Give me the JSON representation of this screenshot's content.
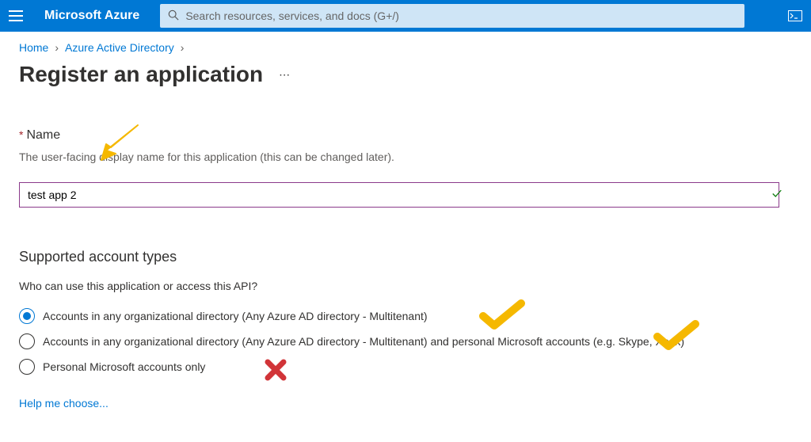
{
  "topbar": {
    "logo": "Microsoft Azure",
    "search_placeholder": "Search resources, services, and docs (G+/)"
  },
  "breadcrumb": {
    "items": [
      "Home",
      "Azure Active Directory"
    ]
  },
  "page": {
    "title": "Register an application"
  },
  "name_section": {
    "label": "Name",
    "description": "The user-facing display name for this application (this can be changed later).",
    "value": "test app 2"
  },
  "account_section": {
    "title": "Supported account types",
    "subtitle": "Who can use this application or access this API?",
    "options": [
      "Accounts in any organizational directory (Any Azure AD directory - Multitenant)",
      "Accounts in any organizational directory (Any Azure AD directory - Multitenant) and personal Microsoft accounts (e.g. Skype, Xbox)",
      "Personal Microsoft accounts only"
    ],
    "selected_index": 0,
    "help_link": "Help me choose..."
  },
  "annotations": {
    "arrow_color": "#f5b800",
    "check_color": "#f5b800",
    "cross_color": "#d83b01"
  }
}
